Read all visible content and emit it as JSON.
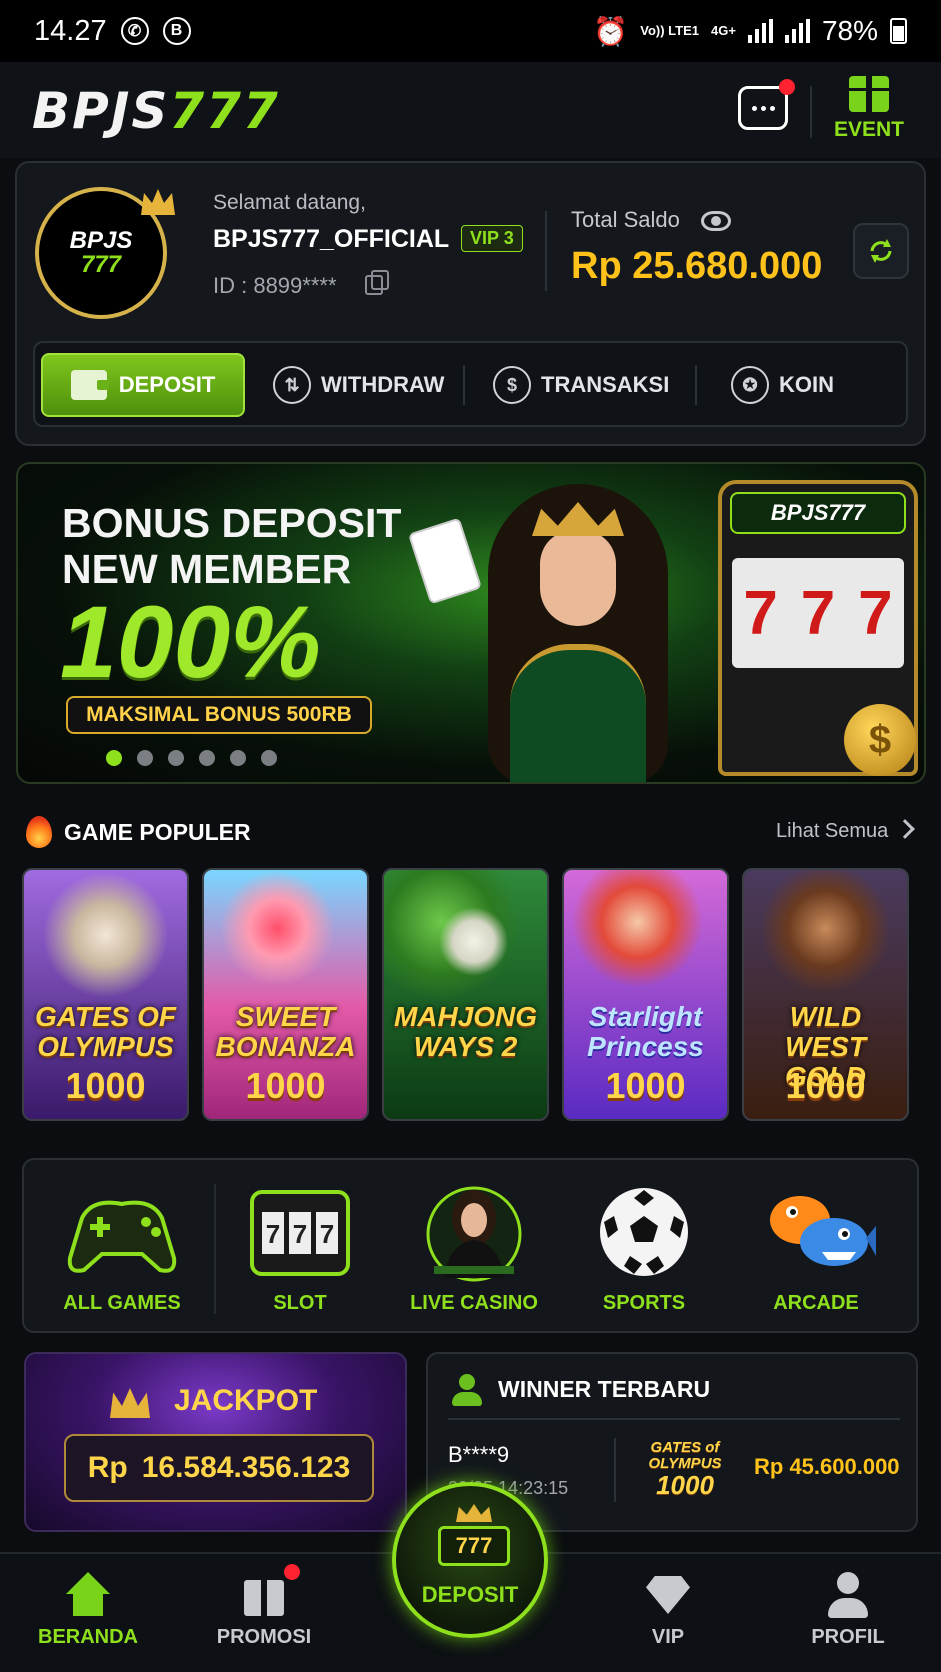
{
  "status_bar": {
    "time": "14.27",
    "network": "Vo)) LTE1",
    "net_type": "4G+",
    "battery": "78%"
  },
  "header": {
    "logo_main": "BPJS",
    "logo_num": "777",
    "event_label": "EVENT"
  },
  "profile": {
    "avatar_text_1": "BPJS",
    "avatar_text_2": "777",
    "welcome": "Selamat datang,",
    "username": "BPJS777_OFFICIAL",
    "vip": "VIP 3",
    "user_id": "ID : 8899****",
    "balance_label": "Total Saldo",
    "balance": "Rp 25.680.000"
  },
  "actions": [
    {
      "label": "DEPOSIT"
    },
    {
      "label": "WITHDRAW"
    },
    {
      "label": "TRANSAKSI"
    },
    {
      "label": "KOIN"
    }
  ],
  "banner": {
    "line1": "BONUS DEPOSIT",
    "line2": "NEW MEMBER",
    "percent": "100%",
    "pill": "MAKSIMAL BONUS 500RB",
    "slot_label": "BPJS777",
    "slot_reels": [
      "7",
      "7",
      "7"
    ],
    "active_slide": 1,
    "slides": 6
  },
  "popular": {
    "title": "GAME POPULER",
    "see_all": "Lihat Semua",
    "games": [
      {
        "name": "GATES OF OLYMPUS",
        "num": "1000",
        "color": "#6a3fb0"
      },
      {
        "name": "SWEET BONANZA",
        "num": "1000",
        "color": "#e35aa8"
      },
      {
        "name": "MAHJONG WAYS 2",
        "num": "",
        "color": "#1f7a2e"
      },
      {
        "name": "Starlight Princess",
        "num": "1000",
        "color": "#7a48d8"
      },
      {
        "name": "WILD WEST GOLD",
        "num": "1000",
        "color": "#6a3a1f"
      }
    ]
  },
  "categories": [
    {
      "label": "ALL GAMES",
      "icon": "gamepad-icon"
    },
    {
      "label": "SLOT",
      "icon": "slot-machine-icon"
    },
    {
      "label": "LIVE CASINO",
      "icon": "dealer-icon"
    },
    {
      "label": "SPORTS",
      "icon": "soccer-ball-icon"
    },
    {
      "label": "ARCADE",
      "icon": "fish-icon"
    }
  ],
  "jackpot": {
    "title": "JACKPOT",
    "currency": "Rp",
    "amount": "16.584.356.123"
  },
  "winner": {
    "title": "WINNER TERBARU",
    "user": "B****9",
    "time": "29/05 14:23:15",
    "game_line1": "GATES of",
    "game_line2": "OLYMPUS",
    "game_line3": "1000",
    "amount": "Rp 45.600.000"
  },
  "bottom_nav": [
    {
      "label": "BERANDA"
    },
    {
      "label": "PROMOSI"
    },
    {
      "label": "DEPOSIT"
    },
    {
      "label": "VIP"
    },
    {
      "label": "PROFIL"
    }
  ],
  "colors": {
    "accent": "#8fe01c",
    "gold": "#ffc21a",
    "bg": "#0b0d10"
  }
}
